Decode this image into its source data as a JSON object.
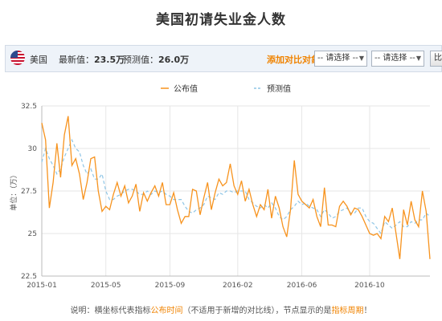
{
  "page_title": "美国初请失业金人数",
  "toolbar": {
    "country": "美国",
    "latest_label": "最新值：",
    "latest_value": "23.5万",
    "forecast_label": "预测值：",
    "forecast_value": "26.0万",
    "compare_label": "添加对比对象：",
    "select1": "-- 请选择 --",
    "select2": "-- 请选择 --",
    "compare_button": "比较",
    "flag_icon": "us-flag-icon"
  },
  "note": {
    "prefix": "说明：横坐标代表指标",
    "part1": "公布时间",
    "part2": "（不适用于新增的对比线）",
    "part3": "，节点显示的是",
    "part4": "指标周期",
    "suffix": "！"
  },
  "colors": {
    "actual": "#f7931e",
    "forecast": "#8ec5e6",
    "highlight": "#f08300"
  },
  "chart_data": {
    "type": "line",
    "ylabel": "单位：（万）",
    "ylim": [
      22.5,
      32.5
    ],
    "yticks": [
      22.5,
      25,
      27.5,
      30,
      32.5
    ],
    "ytick_labels": [
      "22.5",
      "25",
      "27.5",
      "30",
      "32.5"
    ],
    "xlim": [
      0,
      103
    ],
    "xticks": [
      0,
      17,
      34,
      52,
      69,
      87
    ],
    "xtick_labels": [
      "2015-01",
      "2015-05",
      "2015-09",
      "2016-02",
      "2016-06",
      "2016-10"
    ],
    "grid": true,
    "legend_position": "top-center",
    "series": [
      {
        "name": "公布值",
        "values": [
          31.5,
          30.5,
          26.5,
          28.0,
          30.3,
          28.3,
          30.8,
          31.9,
          29.0,
          29.4,
          28.5,
          27.0,
          28.0,
          29.4,
          29.5,
          27.5,
          26.3,
          26.6,
          26.4,
          27.3,
          28.0,
          27.2,
          27.8,
          26.8,
          27.2,
          27.9,
          26.3,
          27.4,
          26.9,
          27.4,
          27.8,
          27.2,
          28.0,
          26.7,
          26.7,
          27.4,
          26.4,
          25.6,
          26.0,
          26.0,
          27.6,
          27.5,
          26.1,
          27.1,
          28.0,
          26.4,
          27.4,
          28.2,
          27.8,
          28.0,
          29.1,
          27.8,
          27.3,
          28.1,
          26.9,
          27.6,
          26.7,
          26.0,
          26.7,
          26.4,
          27.6,
          25.9,
          27.2,
          26.5,
          25.4,
          24.8,
          26.4,
          29.3,
          27.3,
          26.9,
          26.7,
          26.5,
          27.0,
          26.0,
          25.4,
          27.7,
          25.5,
          25.5,
          25.4,
          26.6,
          26.9,
          26.6,
          26.1,
          26.5,
          26.4,
          26.0,
          25.5,
          25.0,
          24.9,
          25.0,
          24.7,
          26.0,
          25.7,
          26.5,
          25.0,
          23.5,
          26.4,
          25.5,
          26.9,
          25.8,
          25.4,
          27.5,
          26.3,
          23.5
        ],
        "color": "#f7931e"
      },
      {
        "name": "预测值",
        "values": [
          29.2,
          30.0,
          29.4,
          29.0,
          28.5,
          28.8,
          29.5,
          30.0,
          30.5,
          30.0,
          29.8,
          29.0,
          28.5,
          28.8,
          28.2,
          28.2,
          28.5,
          27.5,
          27.0,
          27.0,
          27.2,
          27.3,
          27.5,
          27.6,
          27.6,
          27.5,
          27.3,
          27.3,
          27.5,
          27.3,
          27.5,
          27.4,
          27.5,
          27.3,
          27.2,
          27.0,
          27.0,
          27.0,
          26.6,
          26.3,
          26.2,
          26.4,
          26.5,
          26.7,
          27.2,
          27.1,
          27.0,
          27.4,
          27.3,
          27.5,
          27.5,
          27.4,
          27.5,
          27.5,
          27.5,
          27.0,
          26.8,
          26.6,
          26.5,
          26.7,
          26.5,
          26.8,
          26.5,
          26.0,
          25.8,
          26.0,
          26.4,
          26.6,
          26.9,
          26.7,
          26.8,
          26.6,
          26.5,
          26.4,
          26.0,
          26.4,
          26.2,
          25.9,
          26.0,
          26.3,
          26.4,
          26.5,
          26.2,
          26.2,
          26.5,
          26.5,
          26.0,
          25.7,
          25.6,
          25.3,
          25.0,
          25.7,
          25.5,
          25.3,
          25.5,
          25.7,
          25.4,
          25.4,
          25.7,
          25.6,
          25.8,
          25.8,
          26.2,
          26.0
        ],
        "color": "#8ec5e6"
      }
    ]
  }
}
